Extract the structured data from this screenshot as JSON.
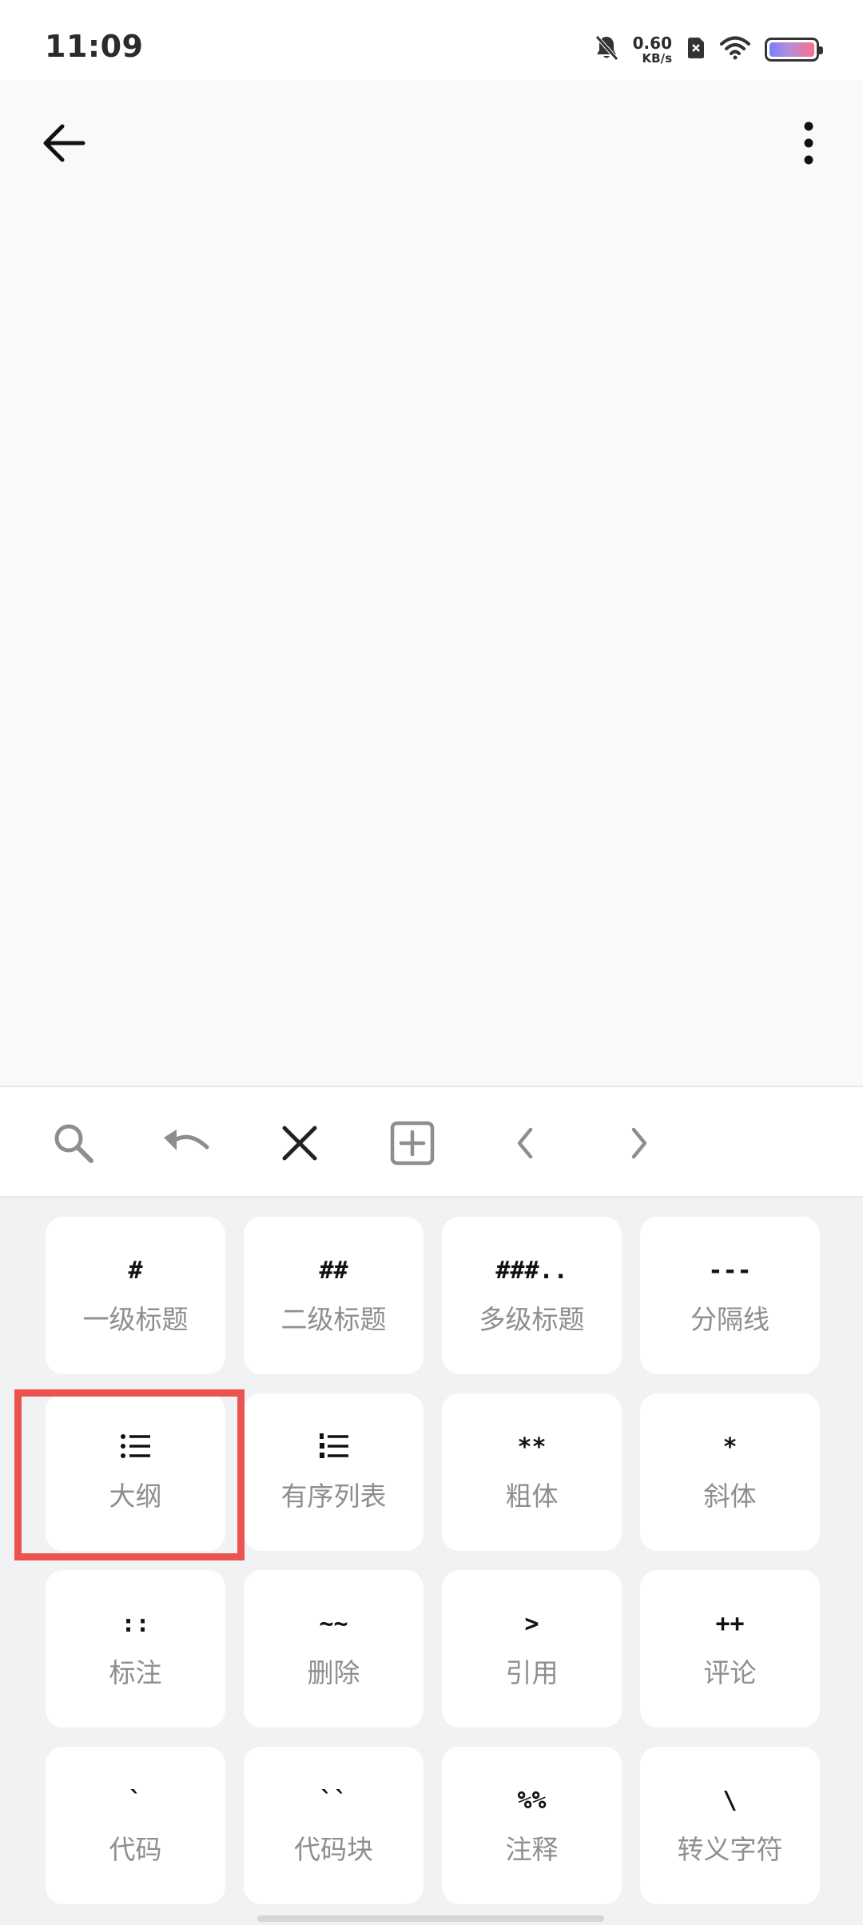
{
  "status_bar": {
    "time": "11:09",
    "net_speed_value": "0.60",
    "net_speed_unit": "KB/s",
    "icons": [
      "bell-off-icon",
      "sim-x-icon",
      "wifi-icon",
      "battery-icon"
    ]
  },
  "app_bar": {
    "back_icon": "arrow-left-icon",
    "more_icon": "more-vertical-icon"
  },
  "toolbar": {
    "tools": [
      "search-icon",
      "undo-icon",
      "close-icon",
      "add-box-icon",
      "chevron-left-icon",
      "chevron-right-icon"
    ]
  },
  "keypad": {
    "keys": [
      {
        "sym": "#",
        "label": "一级标题"
      },
      {
        "sym": "##",
        "label": "二级标题"
      },
      {
        "sym": "###..",
        "label": "多级标题"
      },
      {
        "sym": "---",
        "label": "分隔线"
      },
      {
        "sym": "",
        "label": "大纲",
        "icon": "bullet-list-icon"
      },
      {
        "sym": "",
        "label": "有序列表",
        "icon": "numbered-list-icon"
      },
      {
        "sym": "**",
        "label": "粗体"
      },
      {
        "sym": "*",
        "label": "斜体"
      },
      {
        "sym": "::",
        "label": "标注"
      },
      {
        "sym": "~~",
        "label": "删除"
      },
      {
        "sym": ">",
        "label": "引用"
      },
      {
        "sym": "++",
        "label": "评论"
      },
      {
        "sym": "`",
        "label": "代码"
      },
      {
        "sym": "``",
        "label": "代码块"
      },
      {
        "sym": "%%",
        "label": "注释"
      },
      {
        "sym": "\\",
        "label": "转义字符"
      }
    ]
  },
  "colors": {
    "highlight": "#ea5350",
    "keypad_bg": "#f1f2f4",
    "key_bg": "#ffffff",
    "label": "#8e8e8e"
  }
}
